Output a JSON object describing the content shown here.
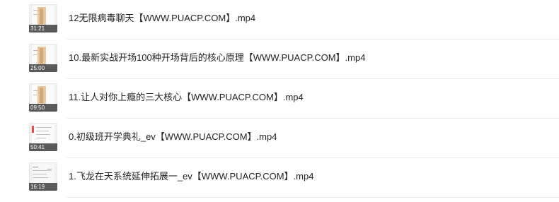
{
  "files": [
    {
      "name": "12无限病毒聊天【WWW.PUACP.COM】.mp4",
      "duration": "31:21",
      "thumb_style": "tan"
    },
    {
      "name": "10.最新实战开场100种开场背后的核心原理【WWW.PUACP.COM】.mp4",
      "duration": "25:00",
      "thumb_style": "tan"
    },
    {
      "name": "11.让人对你上瘾的三大核心【WWW.PUACP.COM】.mp4",
      "duration": "09:50",
      "thumb_style": "tan"
    },
    {
      "name": "0.初级班开学典礼_ev【WWW.PUACP.COM】.mp4",
      "duration": "50:41",
      "thumb_style": "doc-red"
    },
    {
      "name": "1.飞龙在天系统延伸拓展一_ev【WWW.PUACP.COM】.mp4",
      "duration": "16:19",
      "thumb_style": "doc-gray"
    }
  ],
  "colors": {
    "text": "#222222",
    "divider": "#ececec",
    "duration_bar": "#1e1e1e",
    "accent_red": "#e24b4b",
    "thumb_tan": "#e6c9a1"
  },
  "icons": {
    "thumbnail": "video-thumbnail-icon"
  }
}
